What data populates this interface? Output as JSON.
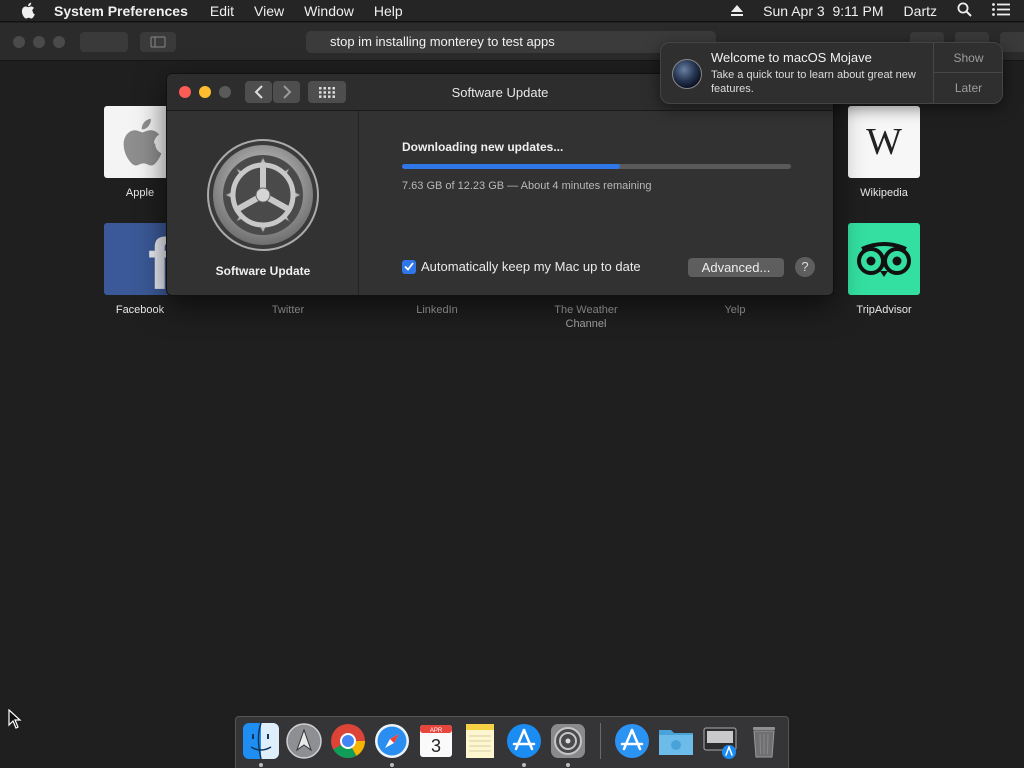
{
  "menubar": {
    "app_name": "System Preferences",
    "items": [
      "Edit",
      "View",
      "Window",
      "Help"
    ],
    "datetime": "Sun Apr 3  9:11 PM",
    "user": "Dartz"
  },
  "safari": {
    "address": "stop im installing monterey to test apps"
  },
  "favorites": [
    {
      "label": "Apple"
    },
    {
      "label": "Wikipedia"
    },
    {
      "label": "Facebook"
    },
    {
      "label": "Twitter"
    },
    {
      "label": "LinkedIn"
    },
    {
      "label": "The Weather Channel"
    },
    {
      "label": "Yelp"
    },
    {
      "label": "TripAdvisor"
    }
  ],
  "notification": {
    "title": "Welcome to macOS Mojave",
    "body": "Take a quick tour to learn about great new features.",
    "show_label": "Show",
    "later_label": "Later"
  },
  "software_update": {
    "window_title": "Software Update",
    "sidebar_name": "Software Update",
    "status": "Downloading new updates...",
    "progress_fraction": 0.56,
    "detail": "7.63 GB of 12.23 GB — About 4 minutes remaining",
    "auto_update_label": "Automatically keep my Mac up to date",
    "auto_update_checked": true,
    "advanced_label": "Advanced...",
    "help_label": "?"
  },
  "dock": {
    "items": [
      "finder-icon",
      "launchpad-icon",
      "chrome-icon",
      "safari-icon",
      "calendar-icon",
      "notes-icon",
      "app-store-icon",
      "system-preferences-icon",
      "app-store-folder-icon",
      "folder-icon",
      "installer-icon",
      "trash-icon"
    ],
    "calendar_month": "APR",
    "calendar_day": "3"
  },
  "colors": {
    "accent": "#2f76e8",
    "tripadvisor": "#34e0a1",
    "facebook": "#3b5998"
  }
}
